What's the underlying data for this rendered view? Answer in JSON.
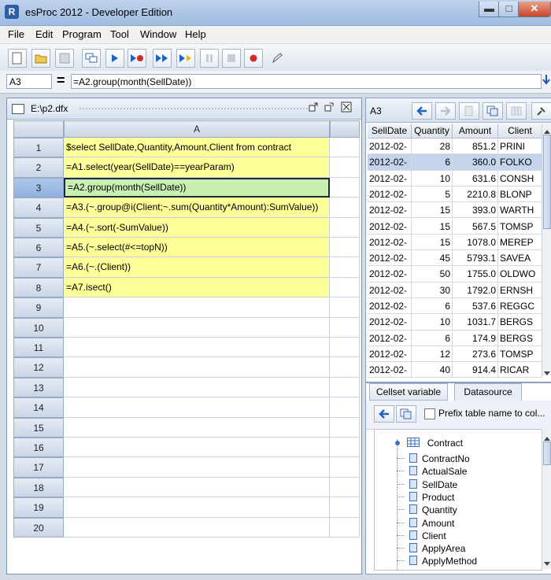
{
  "window": {
    "title": "esProc 2012 - Developer Edition",
    "app_icon": "R",
    "min_icon": "▬",
    "max_icon": "□",
    "close_icon": "✕"
  },
  "menu": [
    "File",
    "Edit",
    "Program",
    "Tool",
    "Window",
    "Help"
  ],
  "formula_bar": {
    "cell_name": "A3",
    "equals": "=",
    "formula": "=A2.group(month(SellDate))"
  },
  "editor": {
    "title": "E:\\p2.dfx",
    "column_header": "A",
    "rows": [
      {
        "num": "1",
        "formula": "$select SellDate,Quantity,Amount,Client from contract"
      },
      {
        "num": "2",
        "formula": "=A1.select(year(SellDate)==yearParam)"
      },
      {
        "num": "3",
        "formula": "=A2.group(month(SellDate))"
      },
      {
        "num": "4",
        "formula": "=A3.(~.group@i(Client;~.sum(Quantity*Amount):SumValue))"
      },
      {
        "num": "5",
        "formula": "=A4.(~.sort(-SumValue))"
      },
      {
        "num": "6",
        "formula": "=A5.(~.select(#<=topN))"
      },
      {
        "num": "7",
        "formula": "=A6.(~.(Client))"
      },
      {
        "num": "8",
        "formula": "=A7.isect()"
      },
      {
        "num": "9",
        "formula": ""
      },
      {
        "num": "10",
        "formula": ""
      },
      {
        "num": "11",
        "formula": ""
      },
      {
        "num": "12",
        "formula": ""
      },
      {
        "num": "13",
        "formula": ""
      },
      {
        "num": "14",
        "formula": ""
      },
      {
        "num": "15",
        "formula": ""
      },
      {
        "num": "16",
        "formula": ""
      },
      {
        "num": "17",
        "formula": ""
      },
      {
        "num": "18",
        "formula": ""
      },
      {
        "num": "19",
        "formula": ""
      },
      {
        "num": "20",
        "formula": ""
      }
    ],
    "active_row": 3
  },
  "result": {
    "cell": "A3",
    "columns": [
      "SellDate",
      "Quantity",
      "Amount",
      "Client"
    ],
    "rows": [
      [
        "2012-02-",
        "28",
        "851.2",
        "PRINI"
      ],
      [
        "2012-02-",
        "6",
        "360.0",
        "FOLKO"
      ],
      [
        "2012-02-",
        "10",
        "631.6",
        "CONSH"
      ],
      [
        "2012-02-",
        "5",
        "2210.8",
        "BLONP"
      ],
      [
        "2012-02-",
        "15",
        "393.0",
        "WARTH"
      ],
      [
        "2012-02-",
        "15",
        "567.5",
        "TOMSP"
      ],
      [
        "2012-02-",
        "15",
        "1078.0",
        "MEREP"
      ],
      [
        "2012-02-",
        "45",
        "5793.1",
        "SAVEA"
      ],
      [
        "2012-02-",
        "50",
        "1755.0",
        "OLDWO"
      ],
      [
        "2012-02-",
        "30",
        "1792.0",
        "ERNSH"
      ],
      [
        "2012-02-",
        "6",
        "537.6",
        "REGGC"
      ],
      [
        "2012-02-",
        "10",
        "1031.7",
        "BERGS"
      ],
      [
        "2012-02-",
        "6",
        "174.9",
        "BERGS"
      ],
      [
        "2012-02-",
        "12",
        "273.6",
        "TOMSP"
      ],
      [
        "2012-02-",
        "40",
        "914.4",
        "RICAR"
      ]
    ],
    "selected_row": 1
  },
  "datasource": {
    "tabs": [
      "Cellset variable",
      "Datasource"
    ],
    "active_tab": "Datasource",
    "prefix_label": "Prefix table name to col...",
    "table_name": "Contract",
    "fields": [
      "ContractNo",
      "ActualSale",
      "SellDate",
      "Product",
      "Quantity",
      "Amount",
      "Client",
      "ApplyArea",
      "ApplyMethod"
    ]
  }
}
